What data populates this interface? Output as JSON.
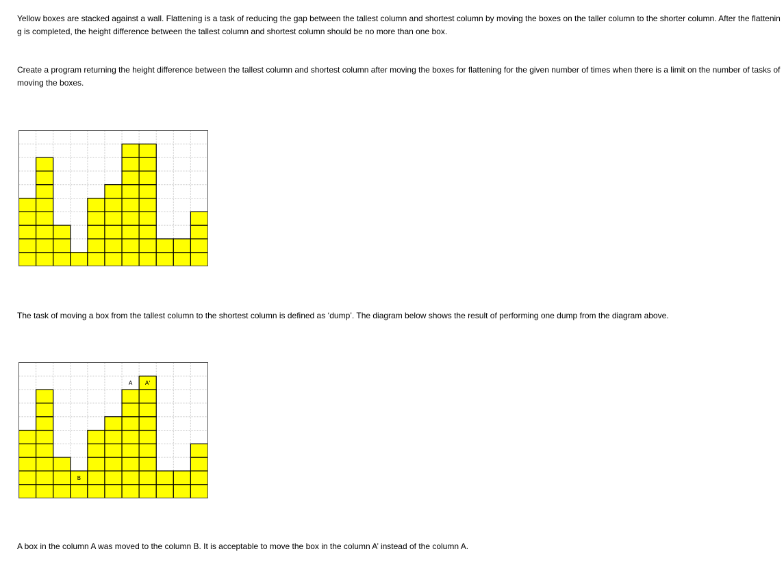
{
  "paragraphs": {
    "intro": "Yellow boxes are stacked against a wall. Flattening is a task of reducing the gap between the tallest column and shortest column by moving the boxes on the taller column to the shorter column. After the flattening is completed, the height difference between the tallest column and shortest column should be no more than one box.",
    "task": "Create a program returning the height difference between the tallest column and shortest column after moving the boxes for flattening for the given number of times when there is a limit on the number of tasks of moving the boxes.",
    "dump_definition": "The task of moving a box from the tallest column to the shortest column is defined as ‘dump’. The diagram below shows the result of performing one dump from the diagram above.",
    "dump_note": "A box in the column A was moved to the column B. It is acceptable to move the box in the column A’ instead of the column A."
  },
  "colors": {
    "box_fill": "#ffff00",
    "box_stroke": "#000000",
    "grid_line": "#c8c8c8",
    "frame": "#555555",
    "background": "#ffffff"
  },
  "diagrams": [
    {
      "id": "initial",
      "grid_columns": 11,
      "grid_rows": 10,
      "column_heights": [
        5,
        8,
        3,
        1,
        5,
        6,
        9,
        9,
        2,
        2,
        4
      ],
      "labels": []
    },
    {
      "id": "after_dump",
      "grid_columns": 11,
      "grid_rows": 10,
      "column_heights": [
        5,
        8,
        3,
        2,
        5,
        6,
        8,
        9,
        2,
        2,
        4
      ],
      "labels": [
        {
          "column": 6,
          "row_from_bottom": 9,
          "text": "A"
        },
        {
          "column": 7,
          "row_from_bottom": 9,
          "text": "A'"
        },
        {
          "column": 3,
          "row_from_bottom": 2,
          "text": "B"
        }
      ]
    }
  ]
}
